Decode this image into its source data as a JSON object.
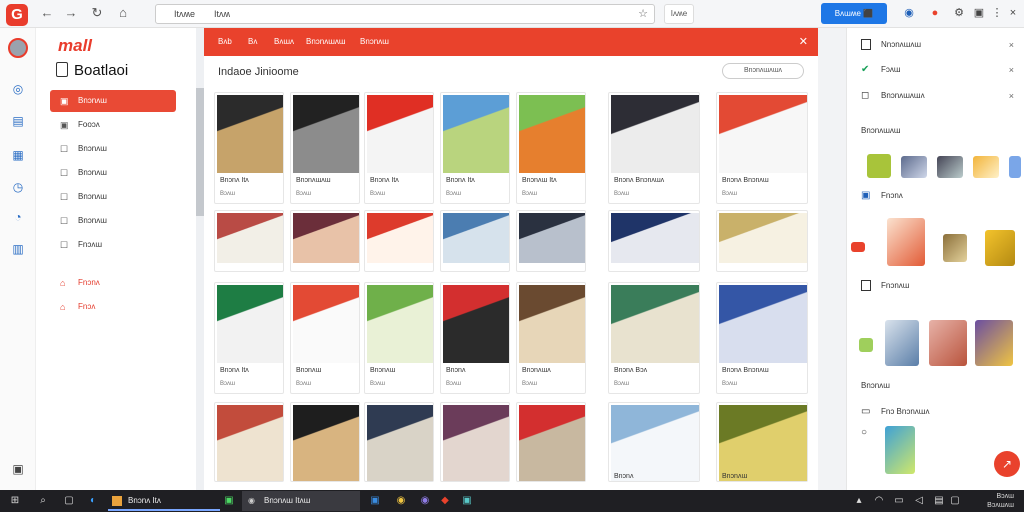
{
  "browser": {
    "logo_letter": "G",
    "tab_text": "Itʌʍe",
    "url": "Itʌʍ",
    "ext_label": "Iʌʍe",
    "sign_button": "Bʌɯʍe  ⬛"
  },
  "leftnav": {
    "brand": "mall",
    "title": "Boatlaoi",
    "items": [
      {
        "label": "Bnɔnʌɯ",
        "icon": "tag-icon",
        "active": true
      },
      {
        "label": "Fooɔʌ",
        "icon": "tag-icon"
      },
      {
        "label": "Bnɔnʌɯ",
        "icon": "square-icon"
      },
      {
        "label": "Bnɔnʌɯ",
        "icon": "square-icon"
      },
      {
        "label": "Bnɔnʌɯ",
        "icon": "square-icon"
      },
      {
        "label": "Bnɔnʌɯ",
        "icon": "square-icon"
      },
      {
        "label": "Fnɔʌɯ",
        "icon": "square-icon"
      }
    ],
    "red_items": [
      {
        "label": "Fnɔnʌ",
        "icon": "home-icon"
      },
      {
        "label": "Fnɔʌ",
        "icon": "home-icon"
      }
    ]
  },
  "main": {
    "top_tabs": [
      "Bʌb",
      "Bʌ",
      "Bʌɯʌ",
      "Bnɔnʌɯʌɯ",
      "Bnɔnʌɯ"
    ],
    "heading": "Indaoe Jinioome",
    "pill": "Bnɔnʌɯʌɯʌ",
    "rows": [
      [
        {
          "caption": "Bnɔnʌ Itʌ",
          "sub": "Bɔʌɯ"
        },
        {
          "caption": "Bnɔnʌɯʌɯ",
          "sub": "Bɔʌɯ"
        },
        {
          "caption": "Bnɔnʌ Itʌ",
          "sub": "Bɔʌɯ"
        },
        {
          "caption": "Bnɔnʌ Itʌ",
          "sub": "Bɔʌɯ"
        },
        {
          "caption": "Bnɔnʌɯ Itʌ",
          "sub": "Bɔʌɯ"
        },
        {
          "caption": "Bnɔnʌ Bnɔnʌɯʌ",
          "sub": "Bɔʌɯ"
        },
        {
          "caption": "Bnɔnʌ Bnɔnʌɯ",
          "sub": "Bɔʌɯ"
        }
      ],
      [
        {
          "caption": "",
          "sub": ""
        },
        {
          "caption": "",
          "sub": ""
        },
        {
          "caption": "",
          "sub": ""
        },
        {
          "caption": "",
          "sub": ""
        },
        {
          "caption": "",
          "sub": ""
        },
        {
          "caption": "",
          "sub": ""
        },
        {
          "caption": "",
          "sub": ""
        }
      ],
      [
        {
          "caption": "Bnɔnʌ Itʌ",
          "sub": "Bɔʌɯ"
        },
        {
          "caption": "Bnɔnʌɯ",
          "sub": "Bɔʌɯ"
        },
        {
          "caption": "Bnɔnʌɯ",
          "sub": "Bɔʌɯ"
        },
        {
          "caption": "Bnɔnʌ",
          "sub": "Bɔʌɯ"
        },
        {
          "caption": "Bnɔnʌɯʌ",
          "sub": "Bɔʌɯ"
        },
        {
          "caption": "Bnɔnʌ Bɔʌ",
          "sub": "Bɔʌɯ"
        },
        {
          "caption": "Bnɔnʌ Bnɔnʌɯ",
          "sub": "Bɔʌɯ"
        }
      ],
      [
        {
          "caption": "",
          "sub": ""
        },
        {
          "caption": "",
          "sub": ""
        },
        {
          "caption": "",
          "sub": ""
        },
        {
          "caption": "",
          "sub": ""
        },
        {
          "caption": "",
          "sub": ""
        },
        {
          "caption": "Bnɔnʌ",
          "sub": ""
        },
        {
          "caption": "Bnɔnʌɯ",
          "sub": ""
        }
      ]
    ]
  },
  "right": {
    "rows": [
      {
        "label": "Nnɔnʌɯʌɯ",
        "icon": "square-icon",
        "close": "×"
      },
      {
        "label": "Fɔʌɯ",
        "icon": "check-icon",
        "close": "×"
      },
      {
        "label": "Bnɔnʌɯʌɯʌ",
        "icon": "square-icon",
        "close": "×"
      }
    ],
    "sections": {
      "s1": "Bnɔnʌɯʌɯ",
      "s2": "Fnɔnʌ",
      "s3": "Fnɔnʌɯ",
      "s4": "Bnɔnʌɯ",
      "s5": "Fnɔ Bnɔnʌɯʌ"
    },
    "s5_icon": "circle-icon"
  },
  "taskbar": {
    "app1": "Bnɔnʌ Itʌ",
    "app2": "Bnɔnʌɯ Itʌɯ",
    "time": "Bɔʌɯ",
    "date": "Bɔʌɯʌɯ"
  },
  "colors": {
    "brand_red": "#e9422c",
    "accent_blue": "#1e77e6"
  }
}
